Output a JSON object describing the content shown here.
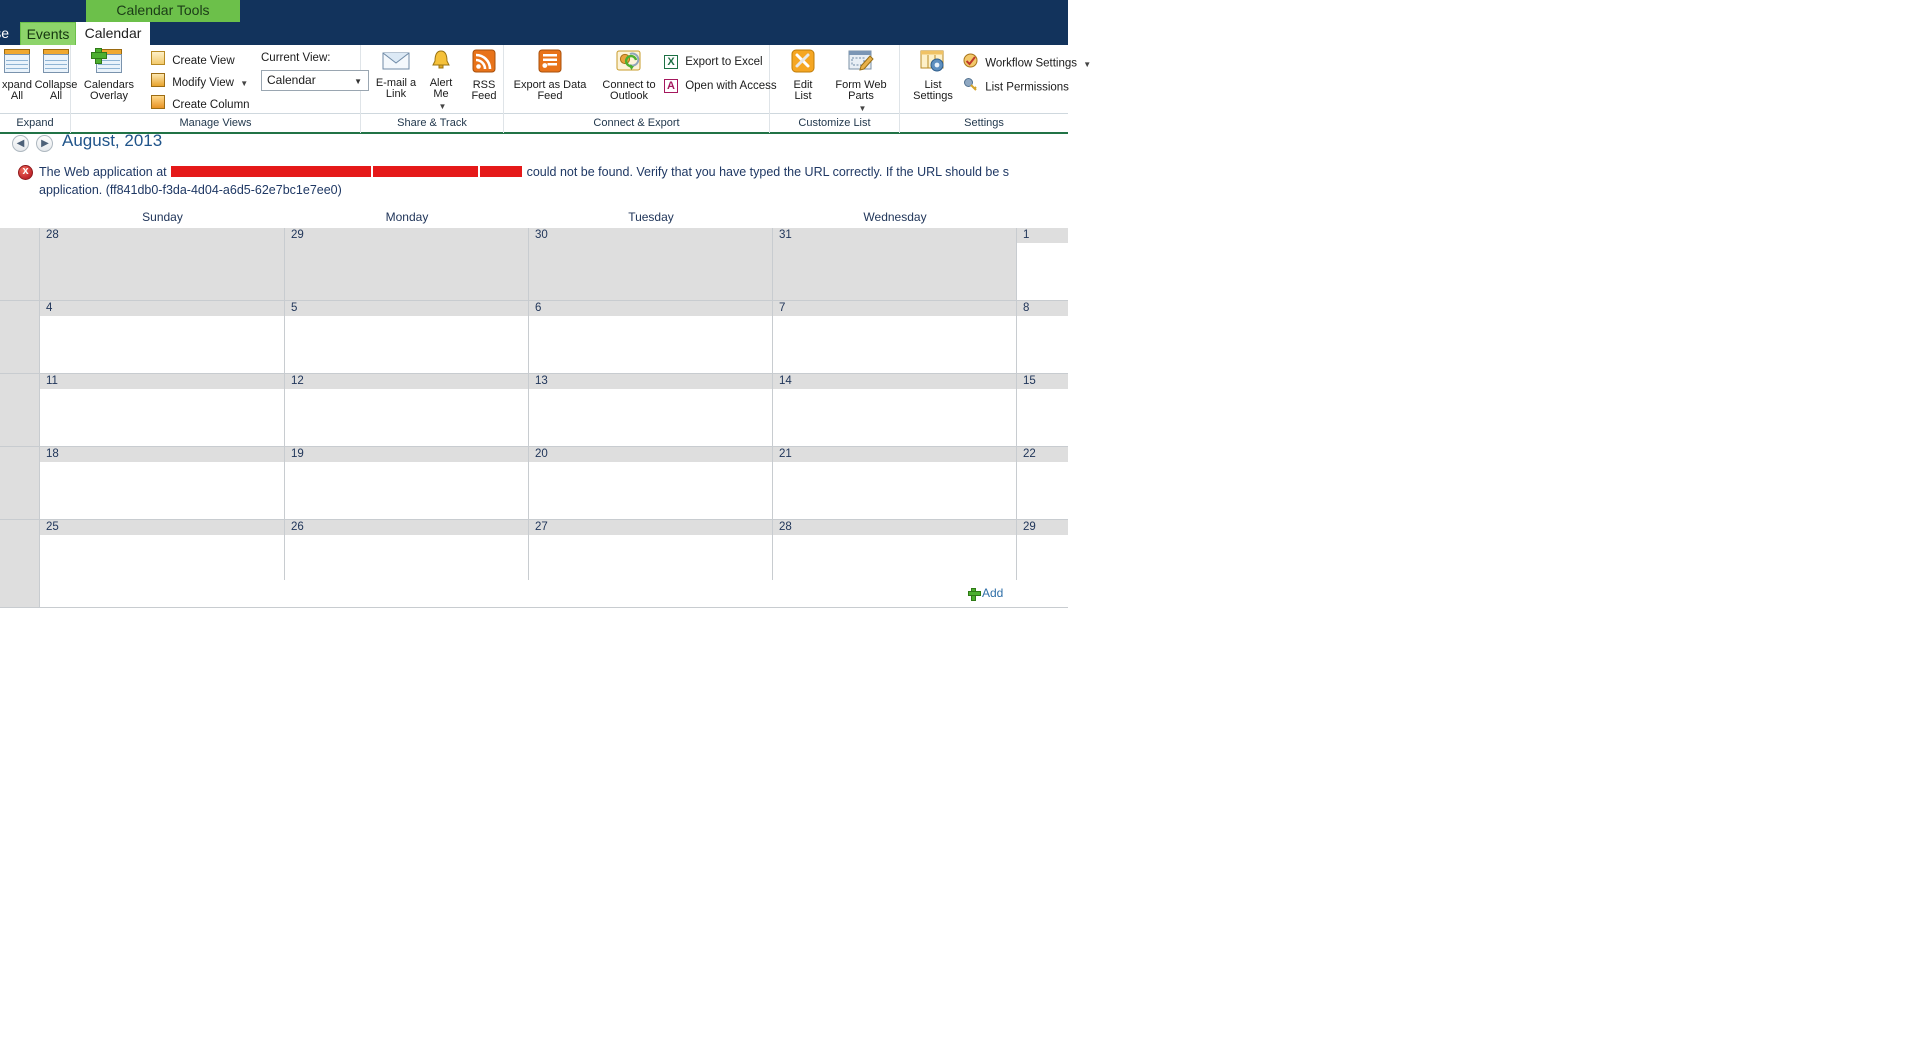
{
  "ribbon": {
    "contextual_title": "Calendar Tools",
    "tabs": [
      {
        "label": "se",
        "name": "tab-browse-partial",
        "active": false
      },
      {
        "label": "Events",
        "name": "tab-events",
        "active": false
      },
      {
        "label": "Calendar",
        "name": "tab-calendar",
        "active": true
      }
    ],
    "groups": [
      {
        "label": "Expand"
      },
      {
        "label": "Manage Views"
      },
      {
        "label": "Share & Track"
      },
      {
        "label": "Connect & Export"
      },
      {
        "label": "Customize List"
      },
      {
        "label": "Settings"
      }
    ],
    "expand_group": {
      "expand_all": "Expand\nAll",
      "expand_all_l1": "xpand",
      "expand_all_l2": "All",
      "collapse_all_l1": "Collapse",
      "collapse_all_l2": "All"
    },
    "manage_views": {
      "calendars_overlay_l1": "Calendars",
      "calendars_overlay_l2": "Overlay",
      "create_view": "Create View",
      "modify_view": "Modify View",
      "create_column": "Create Column",
      "current_view_label": "Current View:",
      "current_view_value": "Calendar"
    },
    "share_track": {
      "email_link_l1": "E-mail a",
      "email_link_l2": "Link",
      "alert_me_l1": "Alert",
      "alert_me_l2": "Me",
      "rss_feed_l1": "RSS",
      "rss_feed_l2": "Feed"
    },
    "connect_export": {
      "export_data_feed_l1": "Export as Data",
      "export_data_feed_l2": "Feed",
      "connect_outlook_l1": "Connect to",
      "connect_outlook_l2": "Outlook",
      "export_excel": "Export to Excel",
      "open_access": "Open with Access"
    },
    "customize_list": {
      "edit_list_l1": "Edit",
      "edit_list_l2": "List",
      "form_web_parts_l1": "Form Web",
      "form_web_parts_l2": "Parts"
    },
    "settings_group": {
      "list_settings_l1": "List",
      "list_settings_l2": "Settings",
      "workflow_settings": "Workflow Settings",
      "list_permissions": "List Permissions"
    }
  },
  "nav": {
    "prev_glyph": "◀",
    "next_glyph": "▶",
    "title": "August, 2013"
  },
  "error": {
    "prefix": "The Web application at ",
    "suffix": " could not be found. Verify that you have typed the URL correctly. If the URL should be s",
    "line2": "application. (ff841db0-f3da-4d04-a6d5-62e7bc1e7ee0)",
    "correlation_id": "ff841db0-f3da-4d04-a6d5-62e7bc1e7ee0"
  },
  "calendar": {
    "day_headers": [
      "Sunday",
      "Monday",
      "Tuesday",
      "Wednesday"
    ],
    "weeks": [
      {
        "days": [
          {
            "num": "28",
            "other_month": true
          },
          {
            "num": "29",
            "other_month": true
          },
          {
            "num": "30",
            "other_month": true
          },
          {
            "num": "31",
            "other_month": true
          },
          {
            "num": "1",
            "other_month": false
          }
        ]
      },
      {
        "days": [
          {
            "num": "4",
            "other_month": false
          },
          {
            "num": "5",
            "other_month": false
          },
          {
            "num": "6",
            "other_month": false
          },
          {
            "num": "7",
            "other_month": false
          },
          {
            "num": "8",
            "other_month": false
          }
        ]
      },
      {
        "days": [
          {
            "num": "11",
            "other_month": false
          },
          {
            "num": "12",
            "other_month": false
          },
          {
            "num": "13",
            "other_month": false
          },
          {
            "num": "14",
            "other_month": false
          },
          {
            "num": "15",
            "other_month": false
          }
        ]
      },
      {
        "days": [
          {
            "num": "18",
            "other_month": false
          },
          {
            "num": "19",
            "other_month": false
          },
          {
            "num": "20",
            "other_month": false
          },
          {
            "num": "21",
            "other_month": false
          },
          {
            "num": "22",
            "other_month": false
          }
        ]
      },
      {
        "days": [
          {
            "num": "25",
            "other_month": false
          },
          {
            "num": "26",
            "other_month": false
          },
          {
            "num": "27",
            "other_month": false
          },
          {
            "num": "28",
            "other_month": false
          },
          {
            "num": "29",
            "other_month": false
          }
        ]
      }
    ],
    "add_label": "Add"
  },
  "colors": {
    "ribbon_navy": "#12335c",
    "ctx_green": "#6cc04a",
    "link_blue": "#2f6fa8",
    "title_blue": "#20548a",
    "error_red": "#c1272d",
    "redaction_red": "#e51919",
    "grid_gray": "#dedede",
    "group_rule_green": "#217346"
  }
}
